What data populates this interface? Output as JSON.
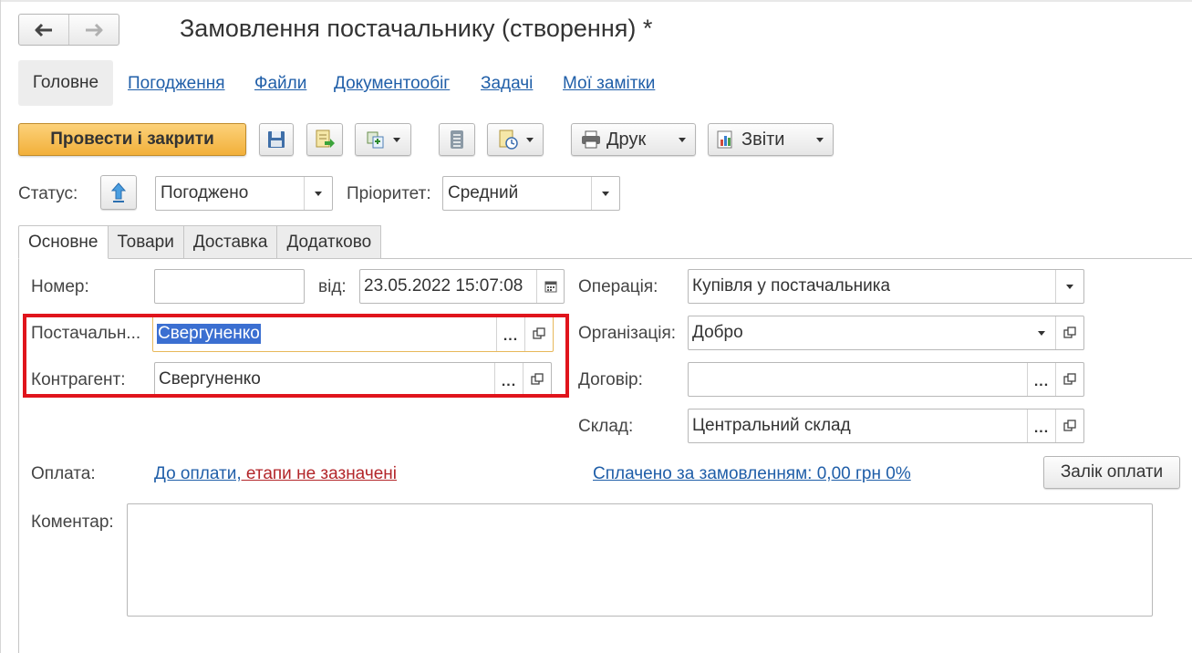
{
  "window": {
    "title": "Замовлення постачальнику (створення) *"
  },
  "nav": {
    "back_icon": "arrow-left-icon",
    "forward_icon": "arrow-right-icon"
  },
  "sections": {
    "active": "Головне",
    "links": [
      "Погодження",
      "Файли",
      "Документообіг",
      "Задачі",
      "Мої замітки"
    ]
  },
  "toolbar": {
    "post_close_label": "Провести і закрити",
    "print_label": "Друк",
    "reports_label": "Звіти"
  },
  "status": {
    "label": "Статус:",
    "value": "Погоджено",
    "priority_label": "Пріоритет:",
    "priority_value": "Средний"
  },
  "tabs": [
    "Основне",
    "Товари",
    "Доставка",
    "Додатково"
  ],
  "form": {
    "number_label": "Номер:",
    "number_value": "",
    "date_from_label": "від:",
    "date_value": "23.05.2022 15:07:08",
    "supplier_label": "Постачальн...",
    "supplier_value": "Свергуненко",
    "counterparty_label": "Контрагент:",
    "counterparty_value": "Свергуненко",
    "operation_label": "Операція:",
    "operation_value": "Купівля у постачальника",
    "organization_label": "Організація:",
    "organization_value": "Добро",
    "contract_label": "Договір:",
    "contract_value": "",
    "warehouse_label": "Склад:",
    "warehouse_value": "Центральний склад"
  },
  "payment": {
    "label": "Оплата:",
    "link_part1": "До оплати,",
    "link_part2": " етапи не зазначені",
    "paid_link": "Сплачено за замовленням: 0,00 грн  0%",
    "offset_button": "Залік оплати"
  },
  "comment": {
    "label": "Коментар:",
    "value": ""
  },
  "colors": {
    "primary_button": "#f2b03a",
    "link": "#1f5ea8",
    "highlight_border": "#e0141c",
    "selection": "#3b6fd1"
  }
}
